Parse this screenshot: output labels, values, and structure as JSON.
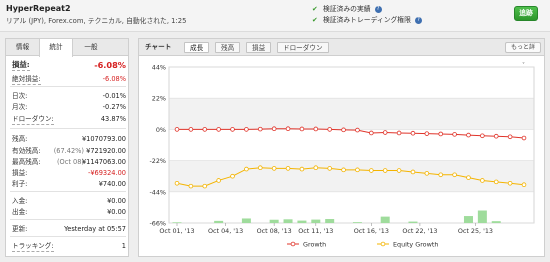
{
  "header": {
    "system_name": "HyperRepeat2",
    "meta": "リアル (JPY), Forex.com, テクニカル, 自動化された, 1:25",
    "verified_track_record": "検証済みの実績",
    "verified_trading_privileges": "検証済みトレーディング権限",
    "follow_button": "追跡"
  },
  "left_panel": {
    "tabs": [
      "情報",
      "統計",
      "一般"
    ],
    "active_tab": "統計",
    "stats": [
      {
        "label": "損益:",
        "value": "-6.08%",
        "highlight": true
      },
      {
        "label": "絶対損益:",
        "value": "-6.08%",
        "negative": true
      },
      {
        "label": "日次:",
        "value": "-0.01%"
      },
      {
        "label": "月次:",
        "value": "-0.27%"
      },
      {
        "label": "ドローダウン:",
        "value": "43.87%"
      },
      {
        "label": "残高:",
        "value": "¥1070793.00"
      },
      {
        "label": "有効残高:",
        "prefix": "(67.42%)",
        "value": "¥721920.00"
      },
      {
        "label": "最高残高:",
        "prefix": "(Oct 08)",
        "value": "¥1147063.00"
      },
      {
        "label": "損益:",
        "value": "-¥69324.00",
        "negative": true
      },
      {
        "label": "利子:",
        "value": "¥740.00"
      },
      {
        "label": "入金:",
        "value": "¥0.00"
      },
      {
        "label": "出金:",
        "value": "¥0.00"
      },
      {
        "label": "更新:",
        "value": "Yesterday at 05:57"
      },
      {
        "label": "トラッキング:",
        "value": "1"
      }
    ]
  },
  "chart_panel": {
    "title": "チャート",
    "tabs": [
      "成長",
      "残高",
      "損益",
      "ドローダウン"
    ],
    "active_tab": "成長",
    "more_button": "もっと詳",
    "zoom_reset": "ˇ"
  },
  "colors": {
    "growth": "#e0342a",
    "equity_growth": "#f4b400",
    "bars": "#9fdc9c",
    "accent_green": "#3a9a2e",
    "negative_red": "#d62020"
  },
  "chart_data": {
    "type": "line",
    "ylim": [
      -66,
      44
    ],
    "yticks": [
      "44%",
      "22%",
      "0%",
      "-22%",
      "-44%",
      "-66%"
    ],
    "ytick_values": [
      44,
      22,
      0,
      -22,
      -44,
      -66
    ],
    "x_labels": [
      "Oct 01, '13",
      "Oct 04, '13",
      "Oct 08, '13",
      "Oct 11, '13",
      "Oct 16, '13",
      "Oct 22, '13",
      "Oct 25, '13"
    ],
    "x_label_positions": [
      0,
      3.5,
      7,
      10,
      14,
      17.5,
      21.5
    ],
    "legend": [
      "Growth",
      "Equity Growth"
    ],
    "series": [
      {
        "name": "Growth",
        "values": [
          0,
          0,
          0,
          0,
          0,
          0,
          0.2,
          0.5,
          0.5,
          0.3,
          0.3,
          0,
          -0.3,
          -0.5,
          -2.5,
          -2.2,
          -2.5,
          -2.7,
          -3,
          -3.2,
          -3.5,
          -4,
          -4.5,
          -4.8,
          -5.2,
          -6.08
        ]
      },
      {
        "name": "Equity Growth",
        "values": [
          -38,
          -40,
          -40,
          -36,
          -33,
          -28,
          -27,
          -27.5,
          -27.5,
          -28,
          -27,
          -27.5,
          -28.5,
          -28.5,
          -29,
          -29,
          -29,
          -30,
          -31,
          -32,
          -32,
          -34,
          -36,
          -37,
          -38,
          -39
        ]
      }
    ],
    "bars": [
      0.5,
      0,
      0,
      1.5,
      0,
      3.2,
      0,
      2.3,
      2.6,
      1.7,
      2.4,
      2.8,
      0,
      0.6,
      0,
      4.5,
      0,
      1.0,
      0,
      0,
      0,
      4.9,
      8.8,
      1.3,
      0,
      0
    ]
  }
}
